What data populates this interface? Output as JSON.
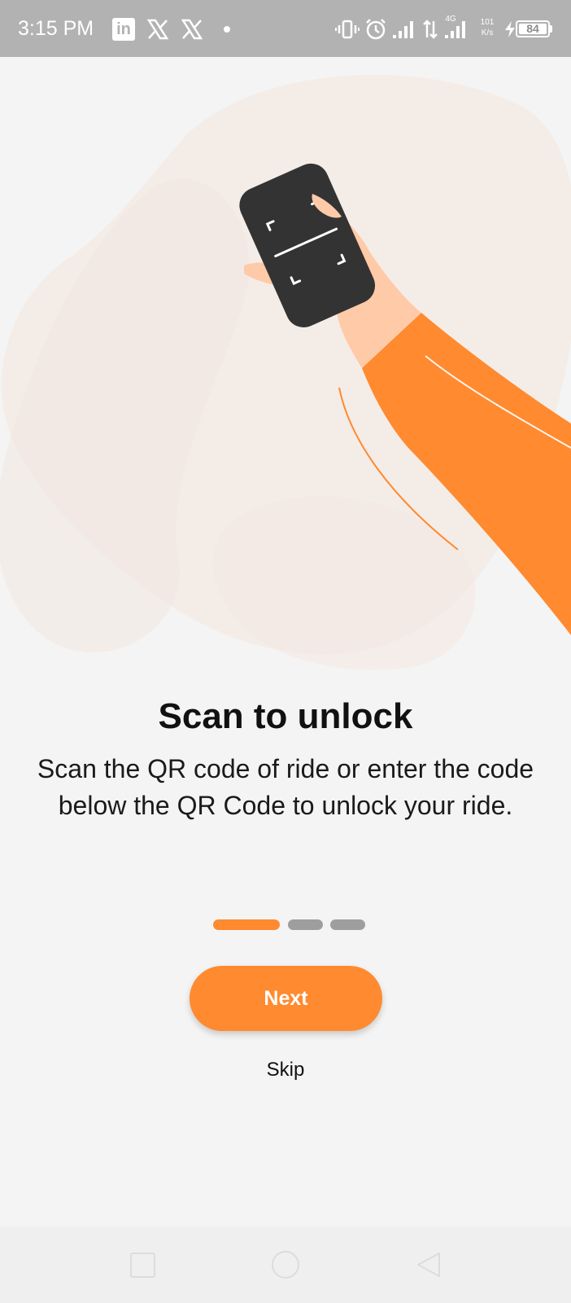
{
  "status_bar": {
    "time": "3:15 PM",
    "network_speed_value": "101",
    "network_speed_unit": "K/s",
    "network_type": "4G",
    "battery_level": "84",
    "icons": [
      "linkedin-icon",
      "x-icon",
      "x-icon",
      "notification-dot",
      "vibrate-icon",
      "alarm-icon",
      "signal-icon",
      "data-transfer-icon",
      "signal-4g-icon",
      "charging-icon",
      "battery-icon"
    ]
  },
  "onboarding": {
    "title": "Scan to unlock",
    "description": "Scan the QR code of ride or enter the code below the QR Code to unlock your ride.",
    "page_indicator": {
      "total": 3,
      "active_index": 0
    },
    "next_label": "Next",
    "skip_label": "Skip"
  },
  "colors": {
    "accent": "#ff8a30",
    "background": "#f4f4f4",
    "blob": "#f4ece7",
    "phone": "#333333",
    "skin": "#ffcaa8",
    "indicator_inactive": "#9e9e9e",
    "status_bar": "#b2b2b2"
  },
  "navigation_bar": {
    "buttons": [
      "recents-button",
      "home-button",
      "back-button"
    ]
  }
}
